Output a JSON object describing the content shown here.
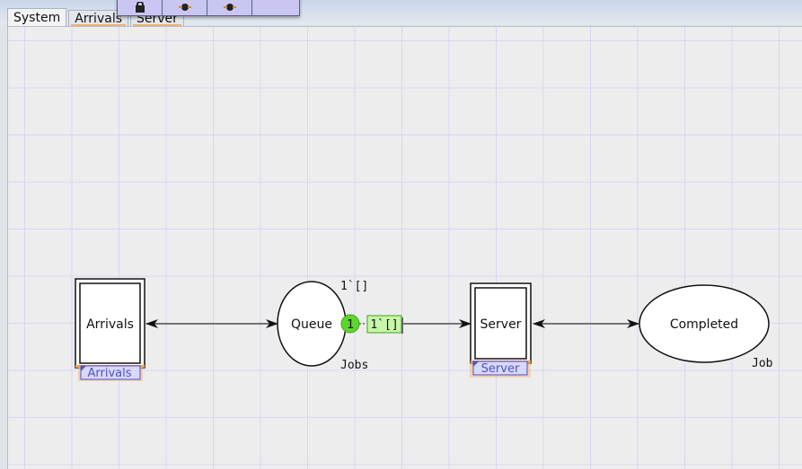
{
  "tabs": [
    {
      "label": "System",
      "active": true
    },
    {
      "label": "Arrivals",
      "active": false
    },
    {
      "label": "Server",
      "active": false
    }
  ],
  "toolbox": {
    "tools": [
      {
        "icon": "lock-icon"
      },
      {
        "icon": "tool-icon"
      },
      {
        "icon": "tool-icon"
      },
      {
        "icon": "blank"
      }
    ]
  },
  "net": {
    "transitions": {
      "arrivals": {
        "label": "Arrivals",
        "subpage_tag": "Arrivals"
      },
      "server": {
        "label": "Server",
        "subpage_tag": "Server"
      }
    },
    "places": {
      "queue": {
        "label": "Queue",
        "initial_marking": "1`[]",
        "colour_set": "Jobs",
        "token_count": "1",
        "current_marking": "1`[]"
      },
      "completed": {
        "label": "Completed",
        "colour_set": "Job"
      }
    }
  },
  "colors": {
    "canvas_bg": "#ededed",
    "grid": "#d6d6f5",
    "toolbox_bg": "#c9c7f1",
    "token_green": "#5cd62a",
    "marking_bg": "#c8f5a8",
    "tag_fill": "#d8d8fa",
    "tag_accent": "#f0a050"
  }
}
